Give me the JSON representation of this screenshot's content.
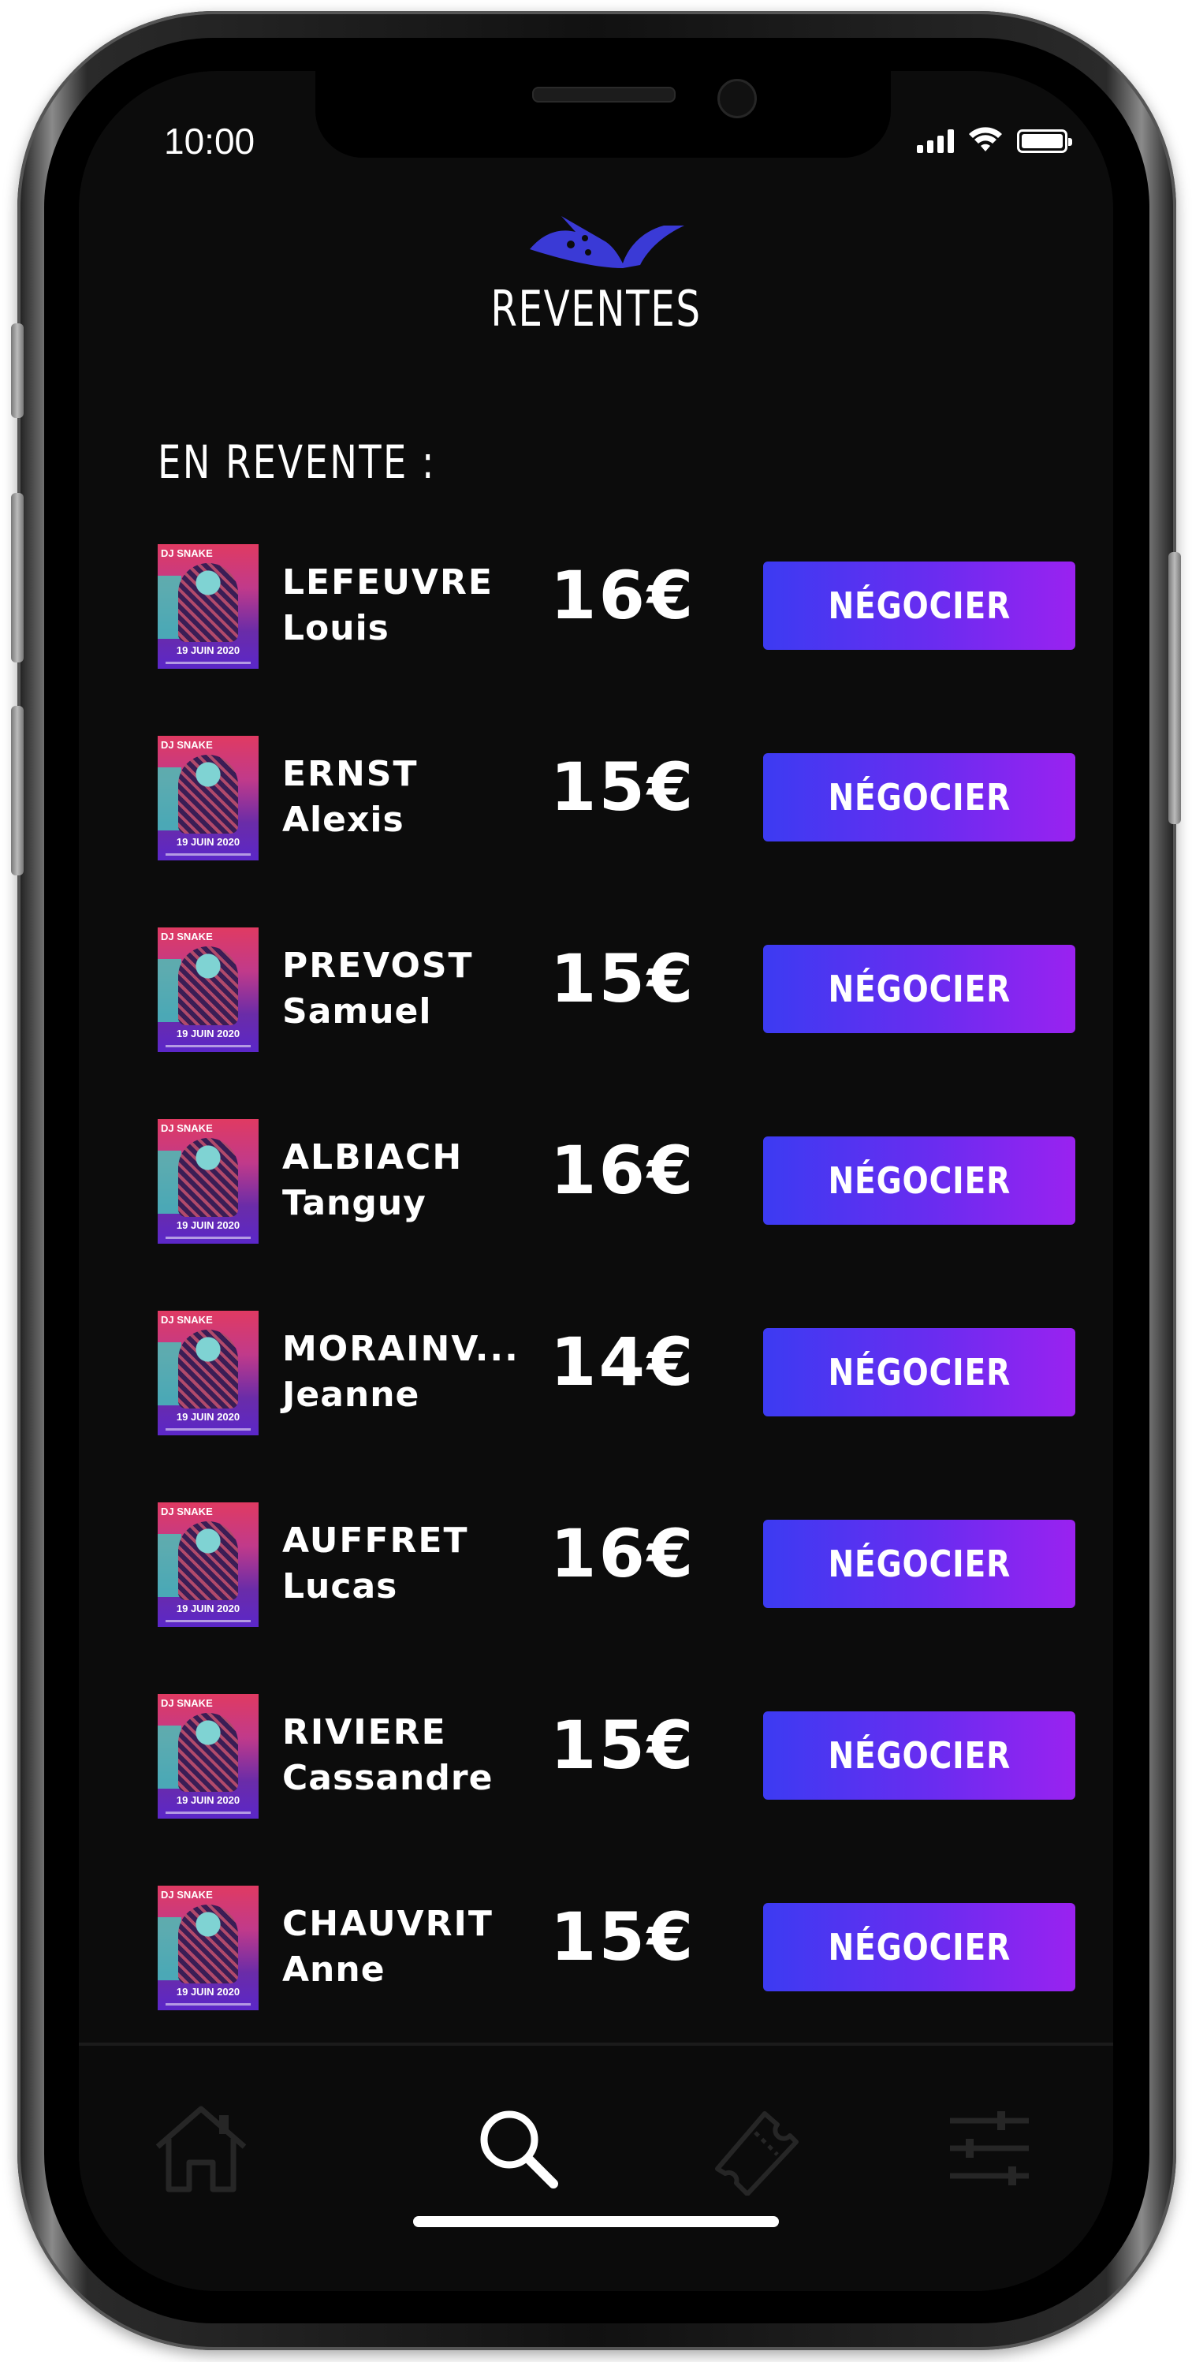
{
  "status_bar": {
    "time": "10:00"
  },
  "header": {
    "title": "REVENTES"
  },
  "section": {
    "heading": "EN REVENTE :"
  },
  "thumbnail": {
    "tag": "DJ SNAKE",
    "date": "19 JUIN 2020"
  },
  "listings": [
    {
      "lastname": "LEFEUVRE",
      "firstname": "Louis",
      "price": "16€",
      "action": "NÉGOCIER"
    },
    {
      "lastname": "ERNST",
      "firstname": "Alexis",
      "price": "15€",
      "action": "NÉGOCIER"
    },
    {
      "lastname": "PREVOST",
      "firstname": "Samuel",
      "price": "15€",
      "action": "NÉGOCIER"
    },
    {
      "lastname": "ALBIACH",
      "firstname": "Tanguy",
      "price": "16€",
      "action": "NÉGOCIER"
    },
    {
      "lastname": "MORAINV...",
      "firstname": "Jeanne",
      "price": "14€",
      "action": "NÉGOCIER"
    },
    {
      "lastname": "AUFFRET",
      "firstname": "Lucas",
      "price": "16€",
      "action": "NÉGOCIER"
    },
    {
      "lastname": "RIVIERE",
      "firstname": "Cassandre",
      "price": "15€",
      "action": "NÉGOCIER"
    },
    {
      "lastname": "CHAUVRIT",
      "firstname": "Anne",
      "price": "15€",
      "action": "NÉGOCIER"
    }
  ],
  "tabbar": {
    "tabs": [
      {
        "icon": "home-icon",
        "active": false
      },
      {
        "icon": "search-icon",
        "active": true
      },
      {
        "icon": "ticket-icon",
        "active": false
      },
      {
        "icon": "sliders-icon",
        "active": false
      }
    ]
  },
  "colors": {
    "accent_start": "#3c3bf2",
    "accent_end": "#9a22f0",
    "logo": "#3a3ad6",
    "background": "#0c0c0c"
  }
}
